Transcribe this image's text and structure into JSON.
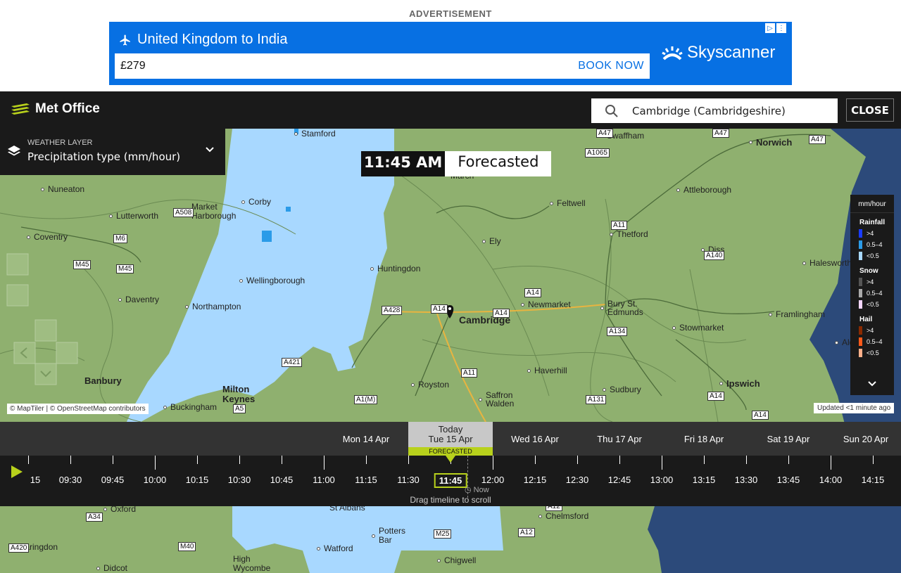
{
  "ad": {
    "label": "ADVERTISEMENT",
    "route": "United Kingdom to India",
    "price": "£279",
    "cta": "BOOK NOW",
    "brand": "Skyscanner"
  },
  "header": {
    "logo": "Met Office",
    "search_value": "Cambridge (Cambridgeshire)",
    "close_label": "CLOSE"
  },
  "layer": {
    "label": "WEATHER LAYER",
    "value": "Precipitation type (mm/hour)"
  },
  "time_chip": {
    "time": "11:45 AM",
    "status": "Forecasted"
  },
  "legend": {
    "unit": "mm/hour",
    "groups": [
      {
        "name": "Rainfall",
        "rows": [
          {
            "label": ">4",
            "color": "#1a3cff"
          },
          {
            "label": "0.5–4",
            "color": "#2b9be8"
          },
          {
            "label": "<0.5",
            "color": "#a8d8ff"
          }
        ]
      },
      {
        "name": "Snow",
        "rows": [
          {
            "label": ">4",
            "color": "#555555"
          },
          {
            "label": "0.5–4",
            "color": "#aaaaaa"
          },
          {
            "label": "<0.5",
            "color": "#f4d6ff"
          }
        ]
      },
      {
        "name": "Hail",
        "rows": [
          {
            "label": ">4",
            "color": "#8a2a00"
          },
          {
            "label": "0.5–4",
            "color": "#ff5a1a"
          },
          {
            "label": "<0.5",
            "color": "#ffb08a"
          }
        ]
      }
    ]
  },
  "map": {
    "places": [
      {
        "name": "Stamford"
      },
      {
        "name": "Swaffham"
      },
      {
        "name": "Norwich"
      },
      {
        "name": "Nuneaton"
      },
      {
        "name": "Corby"
      },
      {
        "name": "Market Harborough"
      },
      {
        "name": "Lutterworth"
      },
      {
        "name": "Coventry"
      },
      {
        "name": "Feltwell"
      },
      {
        "name": "Attleborough"
      },
      {
        "name": "Thetford"
      },
      {
        "name": "Ely"
      },
      {
        "name": "Diss"
      },
      {
        "name": "Halesworth"
      },
      {
        "name": "Huntingdon"
      },
      {
        "name": "Wellingborough"
      },
      {
        "name": "Daventry"
      },
      {
        "name": "Northampton"
      },
      {
        "name": "Newmarket"
      },
      {
        "name": "Bury St. Edmunds"
      },
      {
        "name": "Cambridge"
      },
      {
        "name": "Framlingham"
      },
      {
        "name": "Stowmarket"
      },
      {
        "name": "Haverhill"
      },
      {
        "name": "Banbury"
      },
      {
        "name": "Milton Keynes"
      },
      {
        "name": "Royston"
      },
      {
        "name": "Saffron Walden"
      },
      {
        "name": "Sudbury"
      },
      {
        "name": "Ipswich"
      },
      {
        "name": "Buckingham"
      },
      {
        "name": "Aldeburgh"
      },
      {
        "name": "March"
      }
    ],
    "roads": [
      "A47",
      "A47",
      "A1065",
      "A508",
      "M6",
      "M45",
      "M45",
      "A11",
      "A140",
      "A14",
      "A428",
      "A14",
      "A14",
      "A134",
      "A11",
      "A421",
      "A1(M)",
      "A5",
      "A421",
      "A131",
      "A14",
      "A14"
    ],
    "lower_places": [
      "Oxford",
      "Faringdon",
      "Didcot",
      "High Wycombe",
      "Watford",
      "St Albans",
      "Potters Bar",
      "Chigwell",
      "Chelmsford"
    ],
    "lower_roads": [
      "A34",
      "A420",
      "M40",
      "M25",
      "A12",
      "A12"
    ],
    "attribution": "© MapTiler | © OpenStreetMap contributors",
    "updated": "Updated <1 minute ago"
  },
  "days": [
    {
      "label": "Mon 14 Apr"
    },
    {
      "label": "Today",
      "sub": "Tue 15 Apr",
      "badge": "FORECASTED"
    },
    {
      "label": "Wed 16 Apr"
    },
    {
      "label": "Thu 17 Apr"
    },
    {
      "label": "Fri 18 Apr"
    },
    {
      "label": "Sat 19 Apr"
    },
    {
      "label": "Sun 20 Apr"
    }
  ],
  "timeline": {
    "times": [
      "15",
      "09:30",
      "09:45",
      "10:00",
      "10:15",
      "10:30",
      "10:45",
      "11:00",
      "11:15",
      "11:30",
      "11:45",
      "12:00",
      "12:15",
      "12:30",
      "12:45",
      "13:00",
      "13:15",
      "13:30",
      "13:45",
      "14:00",
      "14:15"
    ],
    "current": "11:45",
    "now_label": "Now",
    "hint": "Drag timeline to scroll"
  }
}
